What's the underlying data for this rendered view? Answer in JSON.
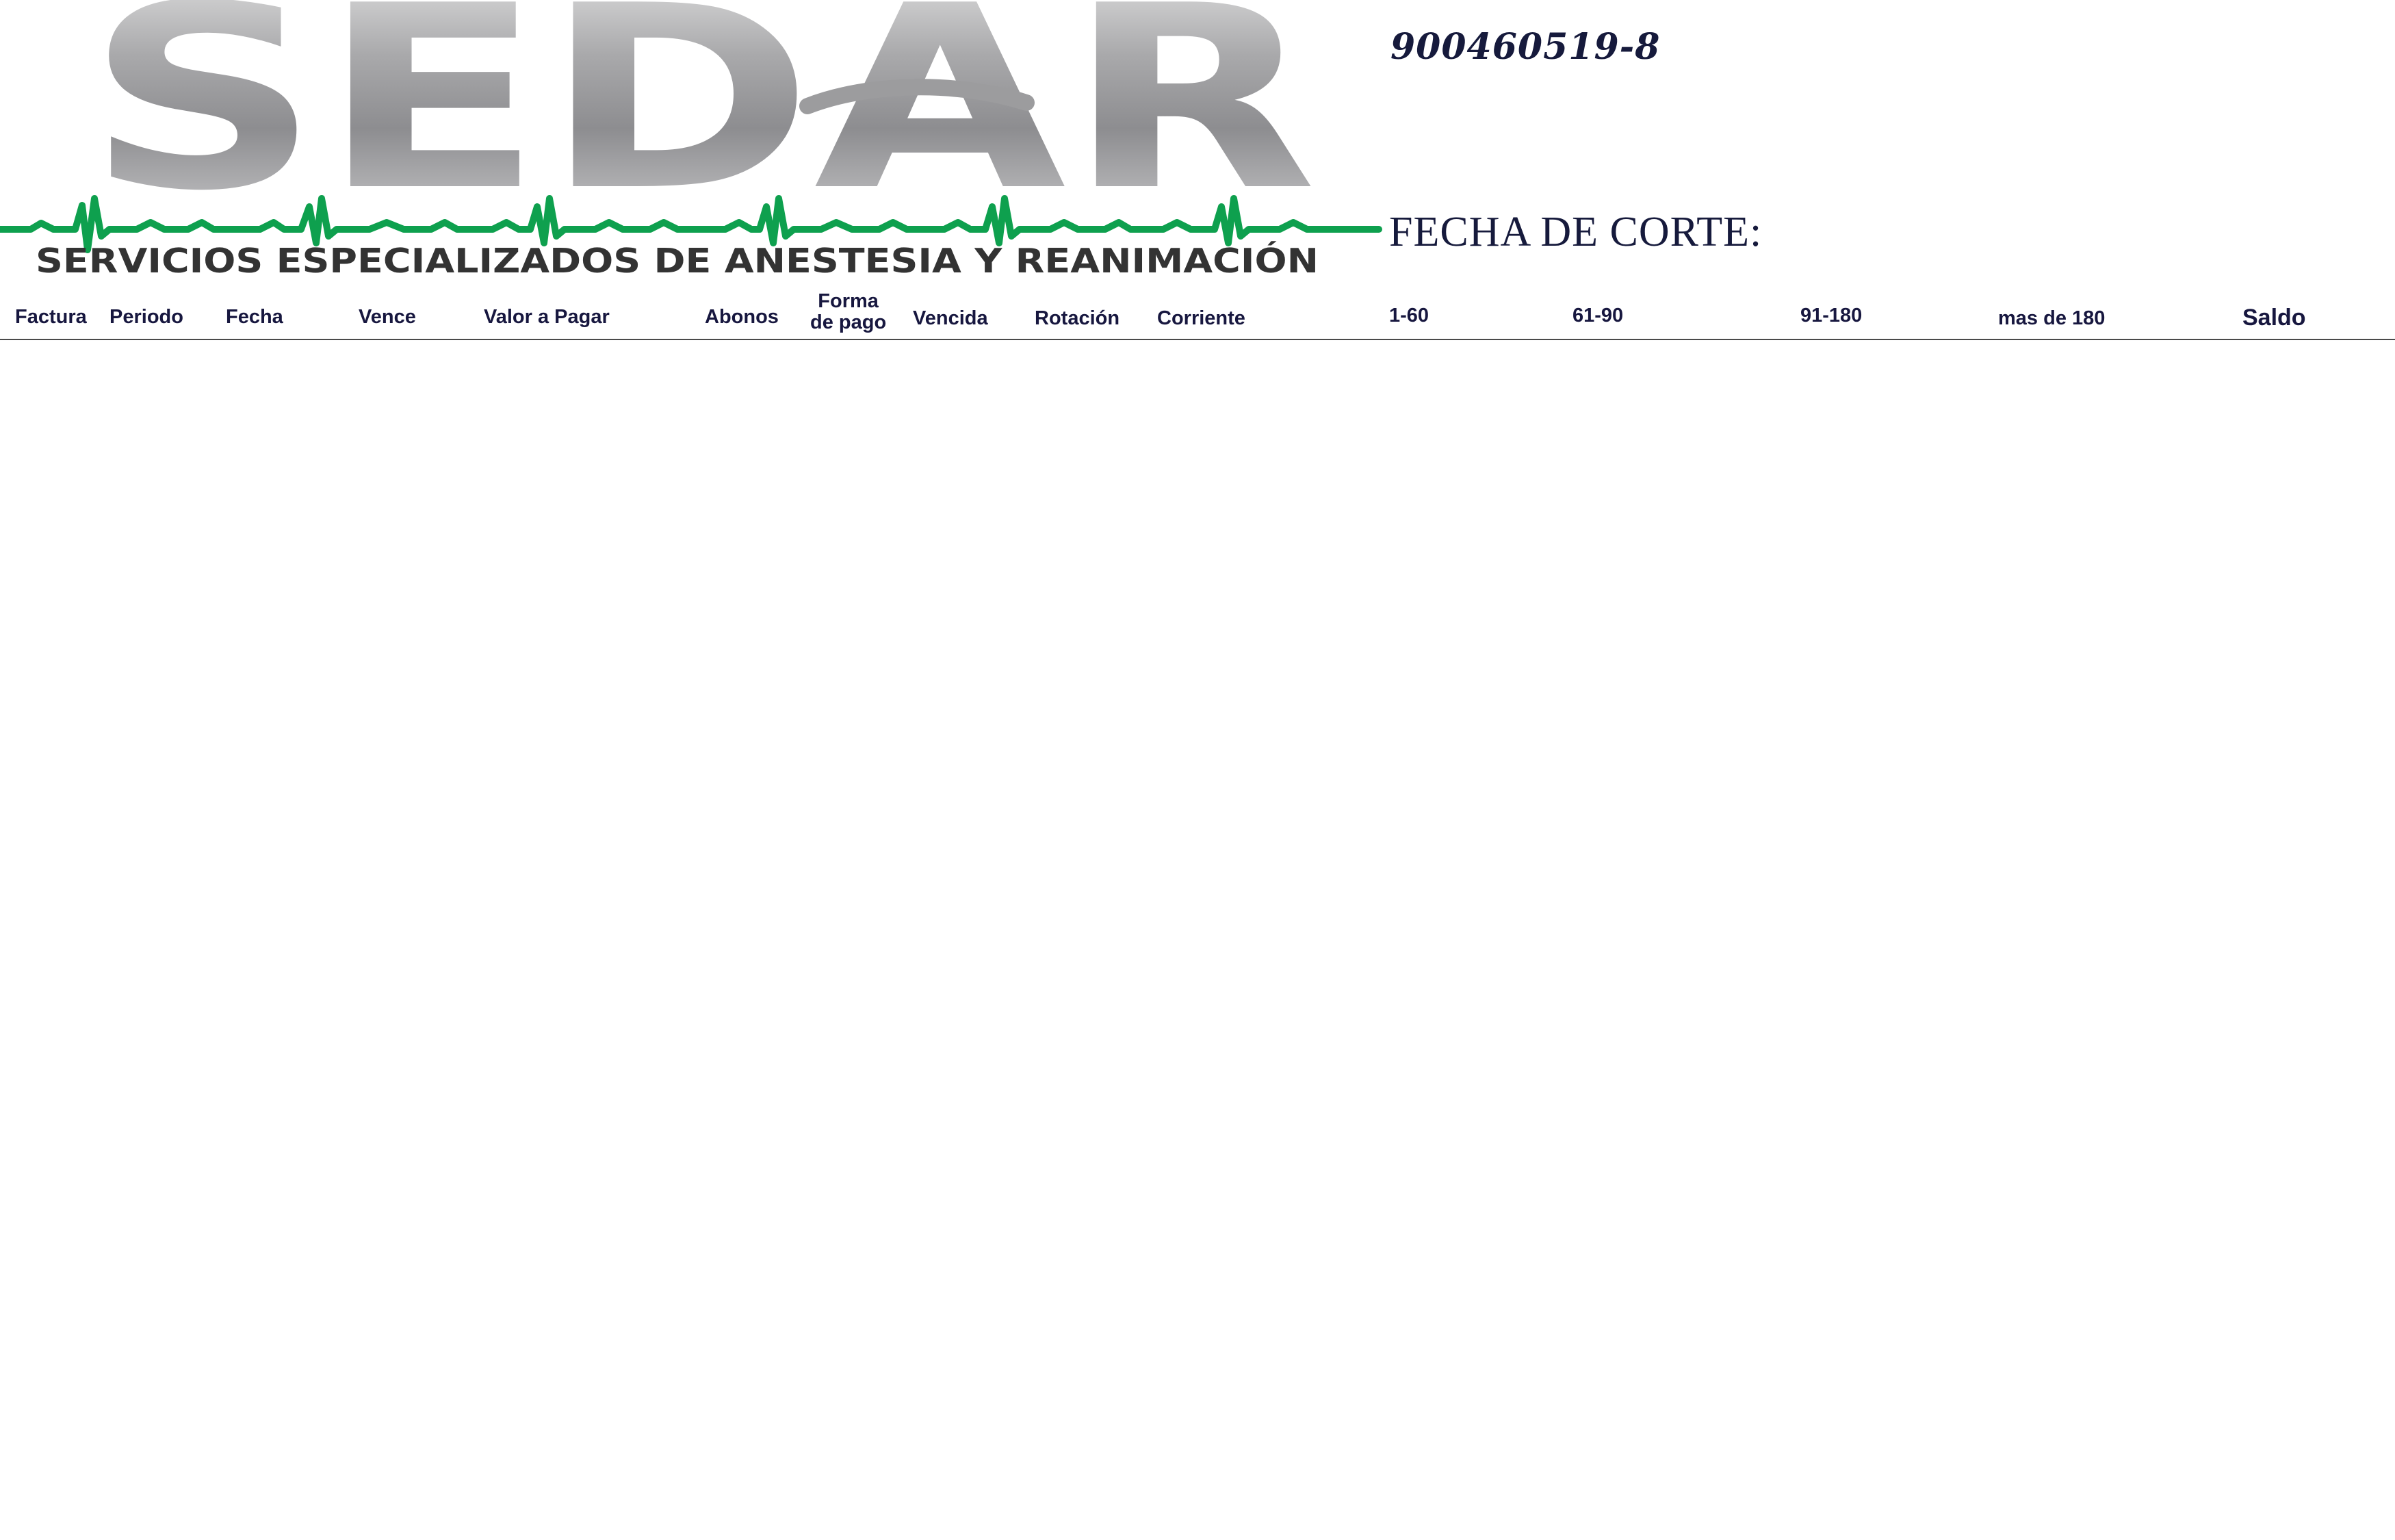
{
  "brand": {
    "logo_text": "SEDAR",
    "tagline": "SERVICIOS ESPECIALIZADOS DE ANESTESIA Y REANIMACIÓN",
    "colors": {
      "logo_gray_light": "#e6e6e6",
      "logo_gray_dark": "#8a8a8c",
      "heartbeat_green": "#0ea04e",
      "tagline_dark": "#333333"
    }
  },
  "nit": "900460519-8",
  "fecha_corte_label": "FECHA DE CORTE:",
  "table": {
    "columns": [
      {
        "key": "factura",
        "label": "Factura"
      },
      {
        "key": "periodo",
        "label": "Periodo"
      },
      {
        "key": "fecha",
        "label": "Fecha"
      },
      {
        "key": "vence",
        "label": "Vence"
      },
      {
        "key": "valor_a_pagar",
        "label": "Valor a Pagar"
      },
      {
        "key": "abonos",
        "label": "Abonos"
      },
      {
        "key": "forma_de_pago",
        "label_line1": "Forma",
        "label_line2": "de pago"
      },
      {
        "key": "vencida",
        "label": "Vencida"
      },
      {
        "key": "rotacion",
        "label": "Rotación"
      },
      {
        "key": "corriente",
        "label": "Corriente"
      },
      {
        "key": "r1_60",
        "label": "1-60"
      },
      {
        "key": "r61_90",
        "label": "61-90"
      },
      {
        "key": "r91_180",
        "label": "91-180"
      },
      {
        "key": "mas_de_180",
        "label": "mas de 180"
      },
      {
        "key": "saldo",
        "label": "Saldo"
      }
    ],
    "rows": []
  }
}
